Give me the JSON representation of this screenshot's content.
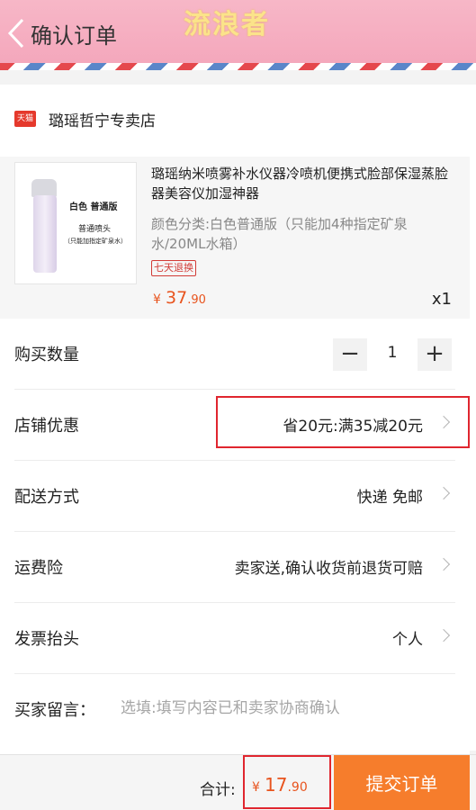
{
  "header": {
    "title": "确认订单",
    "watermark": "流浪者"
  },
  "store": {
    "badge": "天猫",
    "name": "璐瑶哲宁专卖店"
  },
  "product": {
    "thumb_line1": "白色  普通版",
    "thumb_line2": "普通喷头",
    "thumb_line3": "（只能加指定矿泉水）",
    "name": "璐瑶纳米喷雾补水仪器冷喷机便携式脸部保湿蒸脸器美容仪加湿神器",
    "spec": "颜色分类:白色普通版（只能加4种指定矿泉水/20ML水箱）",
    "badge": "七天退换",
    "price_symbol": "¥",
    "price_int": "37",
    "price_dec": ".90",
    "qty": "x1"
  },
  "rows": {
    "quantity": {
      "label": "购买数量",
      "minus": "−",
      "value": "1",
      "plus": "+"
    },
    "discount": {
      "label": "店铺优惠",
      "value": "省20元:满35减20元"
    },
    "delivery": {
      "label": "配送方式",
      "value": "快递 免邮"
    },
    "insurance": {
      "label": "运费险",
      "value": "卖家送,确认收货前退货可赔"
    },
    "invoice": {
      "label": "发票抬头",
      "value": "个人"
    },
    "remark": {
      "label": "买家留言：",
      "placeholder": "选填:填写内容已和卖家协商确认"
    }
  },
  "footer": {
    "total_label": "合计:",
    "price_symbol": "¥",
    "price_int": "17",
    "price_dec": ".90",
    "submit_label": "提交订单"
  },
  "colors": {
    "accent": "#f67d2c",
    "price": "#e8541e",
    "highlight": "#e0262f",
    "header": "#f4a6bb"
  }
}
